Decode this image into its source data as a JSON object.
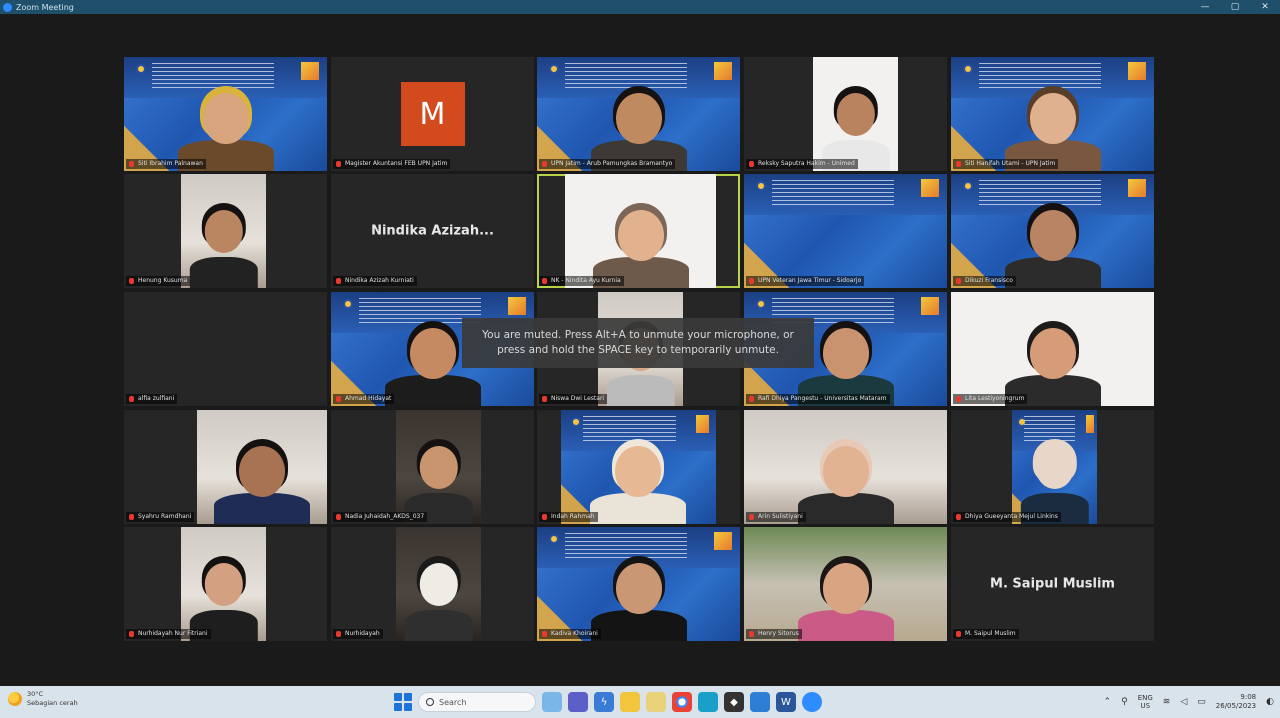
{
  "window": {
    "title": "Zoom Meeting",
    "controls": {
      "minimize": "—",
      "restore": "▢",
      "close": "✕"
    }
  },
  "participants": [
    {
      "name": "Siti Ibrahim Palnawan",
      "bg": "blue",
      "kind": "video",
      "skin": "#d9a57f",
      "body": "#6b4a2b",
      "hair": "#d9b33a"
    },
    {
      "name": "Magister Akuntansi FEB UPN Jatim",
      "bg": "avatar",
      "kind": "avatar",
      "initial": "M"
    },
    {
      "name": "UPN Jatim - Arub Pamungkas Bramantyo",
      "bg": "blue",
      "kind": "video",
      "skin": "#c08a60",
      "body": "#3d3a35",
      "hair": "#161210"
    },
    {
      "name": "Reksky Saputra Hakim - Unimed",
      "bg": "white",
      "kind": "video",
      "skin": "#b9835f",
      "body": "#e8e8e8",
      "hair": "#141110"
    },
    {
      "name": "Siti Hanifah Utami - UPN Jatim",
      "bg": "blue",
      "kind": "video",
      "skin": "#e0b18f",
      "body": "#7a5840",
      "hair": "#5a3d26"
    },
    {
      "name": "Henung Kusuma",
      "bg": "room",
      "kind": "video",
      "skin": "#b98661",
      "body": "#222",
      "hair": "#141110"
    },
    {
      "name": "Nindika Azizah Kurniati",
      "bg": "none",
      "kind": "text",
      "display": "Nindika Azizah..."
    },
    {
      "name": "NK - Nindita Ayu Kurnia",
      "bg": "white",
      "kind": "video",
      "skin": "#e2b28f",
      "body": "#6e5a4a",
      "hair": "#7b6657"
    },
    {
      "name": "UPN Veteran Jawa Timur - Sidoarjo",
      "bg": "blue",
      "kind": "banner"
    },
    {
      "name": "Dikuzi Fransisco",
      "bg": "blue",
      "kind": "video",
      "skin": "#b98463",
      "body": "#2c2c2c",
      "hair": "#141110"
    },
    {
      "name": "alfia zulfiani",
      "bg": "none",
      "kind": "empty"
    },
    {
      "name": "Ahmad Hidayat",
      "bg": "blue",
      "kind": "video",
      "skin": "#c58a62",
      "body": "#1c1c1c",
      "hair": "#141110"
    },
    {
      "name": "Niswa Dwi Lestari",
      "bg": "room",
      "kind": "video",
      "skin": "#d7a786",
      "body": "#bbb",
      "hair": "#3b2c22"
    },
    {
      "name": "Rafi Dhiya Pangestu - Universitas Mataram",
      "bg": "blue",
      "kind": "video",
      "skin": "#c99370",
      "body": "#1b3a3f",
      "hair": "#141110"
    },
    {
      "name": "Lita Lestiyoningrum",
      "bg": "white",
      "kind": "video",
      "skin": "#d59c77",
      "body": "#2b2b2b",
      "hair": "#1d1a1a"
    },
    {
      "name": "Syahru Ramdhani",
      "bg": "room",
      "kind": "video",
      "skin": "#a87352",
      "body": "#1f2c55",
      "hair": "#141110"
    },
    {
      "name": "Nadia Juhaidah_AKDS_037",
      "bg": "dark",
      "kind": "video",
      "skin": "#c8956e",
      "body": "#2a2a2a",
      "hair": "#141110"
    },
    {
      "name": "Indah Rahmah",
      "bg": "blue",
      "kind": "video",
      "skin": "#e6b894",
      "body": "#e9e3d8",
      "hair": "#efe7da"
    },
    {
      "name": "Arin Sulistiyani",
      "bg": "room",
      "kind": "video",
      "skin": "#e2b393",
      "body": "#2a2a2a",
      "hair": "#e7c9b6"
    },
    {
      "name": "Dhiya Gueeyanta Mejul Linkins",
      "bg": "blue",
      "kind": "video",
      "skin": "#e8d6c8",
      "body": "#1c2c40",
      "hair": "#e8d6c8"
    },
    {
      "name": "Nurhidayah Nur Fitriani",
      "bg": "room",
      "kind": "video",
      "skin": "#d3a181",
      "body": "#1e1e1e",
      "hair": "#141110"
    },
    {
      "name": "Nurhidayah",
      "bg": "dark",
      "kind": "video",
      "skin": "#efece6",
      "body": "#2f2f2f",
      "hair": "#1a1a1a"
    },
    {
      "name": "Kadiva Khoirani",
      "bg": "blue",
      "kind": "video",
      "skin": "#c99774",
      "body": "#141414",
      "hair": "#141414"
    },
    {
      "name": "Henry Sitorus",
      "bg": "green",
      "kind": "video",
      "skin": "#d8a481",
      "body": "#c95b86",
      "hair": "#1c1714"
    },
    {
      "name": "M. Saipul Muslim",
      "bg": "none",
      "kind": "text",
      "display": "M. Saipul Muslim"
    }
  ],
  "toast": "You are muted. Press Alt+A to unmute your microphone, or press and hold the SPACE key to temporarily unmute.",
  "taskbar": {
    "weather_temp": "30°C",
    "weather_desc": "Sebagian cerah",
    "search_placeholder": "Search",
    "lang_line1": "ENG",
    "lang_line2": "US",
    "time": "9:08",
    "date": "26/05/2023",
    "accent": "#1e73d8"
  }
}
